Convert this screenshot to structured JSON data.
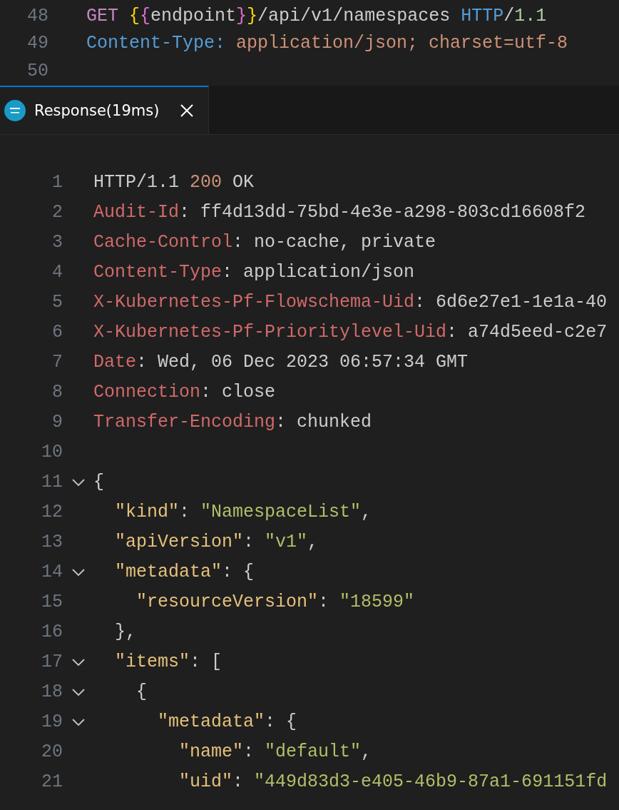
{
  "request_editor": {
    "lines": [
      {
        "number": "48",
        "tokens": [
          {
            "kind": "keyword",
            "text": "GET "
          },
          {
            "kind": "brace-outer",
            "text": "{"
          },
          {
            "kind": "brace-inner",
            "text": "{"
          },
          {
            "kind": "plain",
            "text": "endpoint"
          },
          {
            "kind": "brace-inner",
            "text": "}"
          },
          {
            "kind": "brace-outer",
            "text": "}"
          },
          {
            "kind": "plain",
            "text": "/api/v1/namespaces "
          },
          {
            "kind": "protocol",
            "text": "HTTP"
          },
          {
            "kind": "plain",
            "text": "/"
          },
          {
            "kind": "number",
            "text": "1.1"
          }
        ]
      },
      {
        "number": "49",
        "tokens": [
          {
            "kind": "request-header",
            "text": "Content-Type: "
          },
          {
            "kind": "request-value",
            "text": "application/json; charset=utf-8"
          }
        ]
      },
      {
        "number": "50"
      }
    ]
  },
  "tab": {
    "label": "Response(19ms)",
    "selected": true
  },
  "response": {
    "lines": [
      {
        "number": "1",
        "foldable": false,
        "tokens": [
          {
            "kind": "plain",
            "text": "HTTP/1.1 "
          },
          {
            "kind": "status",
            "text": "200"
          },
          {
            "kind": "plain",
            "text": " OK"
          }
        ]
      },
      {
        "number": "2",
        "foldable": false,
        "tokens": [
          {
            "kind": "header-name",
            "text": "Audit-Id"
          },
          {
            "kind": "plain",
            "text": ": ff4d13dd-75bd-4e3e-a298-803cd16608f2"
          }
        ]
      },
      {
        "number": "3",
        "foldable": false,
        "tokens": [
          {
            "kind": "header-name",
            "text": "Cache-Control"
          },
          {
            "kind": "plain",
            "text": ": no-cache, private"
          }
        ]
      },
      {
        "number": "4",
        "foldable": false,
        "tokens": [
          {
            "kind": "header-name",
            "text": "Content-Type"
          },
          {
            "kind": "plain",
            "text": ": application/json"
          }
        ]
      },
      {
        "number": "5",
        "foldable": false,
        "tokens": [
          {
            "kind": "header-name",
            "text": "X-Kubernetes-Pf-Flowschema-Uid"
          },
          {
            "kind": "plain",
            "text": ": 6d6e27e1-1e1a-40"
          }
        ]
      },
      {
        "number": "6",
        "foldable": false,
        "tokens": [
          {
            "kind": "header-name",
            "text": "X-Kubernetes-Pf-Prioritylevel-Uid"
          },
          {
            "kind": "plain",
            "text": ": a74d5eed-c2e7"
          }
        ]
      },
      {
        "number": "7",
        "foldable": false,
        "tokens": [
          {
            "kind": "header-name",
            "text": "Date"
          },
          {
            "kind": "plain",
            "text": ": Wed, 06 Dec 2023 06:57:34 GMT"
          }
        ]
      },
      {
        "number": "8",
        "foldable": false,
        "tokens": [
          {
            "kind": "header-name",
            "text": "Connection"
          },
          {
            "kind": "plain",
            "text": ": close"
          }
        ]
      },
      {
        "number": "9",
        "foldable": false,
        "tokens": [
          {
            "kind": "header-name",
            "text": "Transfer-Encoding"
          },
          {
            "kind": "plain",
            "text": ": chunked"
          }
        ]
      },
      {
        "number": "10",
        "foldable": false
      },
      {
        "number": "11",
        "foldable": true,
        "tokens": [
          {
            "kind": "plain",
            "text": "{"
          }
        ]
      },
      {
        "number": "12",
        "foldable": false,
        "tokens": [
          {
            "kind": "json-key",
            "text": "  \"kind\""
          },
          {
            "kind": "plain",
            "text": ": "
          },
          {
            "kind": "json-string",
            "text": "\"NamespaceList\""
          },
          {
            "kind": "plain",
            "text": ","
          }
        ]
      },
      {
        "number": "13",
        "foldable": false,
        "tokens": [
          {
            "kind": "json-key",
            "text": "  \"apiVersion\""
          },
          {
            "kind": "plain",
            "text": ": "
          },
          {
            "kind": "json-string",
            "text": "\"v1\""
          },
          {
            "kind": "plain",
            "text": ","
          }
        ]
      },
      {
        "number": "14",
        "foldable": true,
        "tokens": [
          {
            "kind": "json-key",
            "text": "  \"metadata\""
          },
          {
            "kind": "plain",
            "text": ": {"
          }
        ]
      },
      {
        "number": "15",
        "foldable": false,
        "tokens": [
          {
            "kind": "json-key",
            "text": "    \"resourceVersion\""
          },
          {
            "kind": "plain",
            "text": ": "
          },
          {
            "kind": "json-string",
            "text": "\"18599\""
          }
        ]
      },
      {
        "number": "16",
        "foldable": false,
        "tokens": [
          {
            "kind": "plain",
            "text": "  },"
          }
        ]
      },
      {
        "number": "17",
        "foldable": true,
        "tokens": [
          {
            "kind": "json-key",
            "text": "  \"items\""
          },
          {
            "kind": "plain",
            "text": ": ["
          }
        ]
      },
      {
        "number": "18",
        "foldable": true,
        "tokens": [
          {
            "kind": "plain",
            "text": "    {"
          }
        ]
      },
      {
        "number": "19",
        "foldable": true,
        "tokens": [
          {
            "kind": "json-key",
            "text": "      \"metadata\""
          },
          {
            "kind": "plain",
            "text": ": {"
          }
        ]
      },
      {
        "number": "20",
        "foldable": false,
        "tokens": [
          {
            "kind": "json-key",
            "text": "        \"name\""
          },
          {
            "kind": "plain",
            "text": ": "
          },
          {
            "kind": "json-string",
            "text": "\"default\""
          },
          {
            "kind": "plain",
            "text": ","
          }
        ]
      },
      {
        "number": "21",
        "foldable": false,
        "tokens": [
          {
            "kind": "json-key",
            "text": "        \"uid\""
          },
          {
            "kind": "plain",
            "text": ": "
          },
          {
            "kind": "json-string",
            "text": "\"449d83d3-e405-46b9-87a1-691151fd"
          }
        ]
      }
    ]
  }
}
